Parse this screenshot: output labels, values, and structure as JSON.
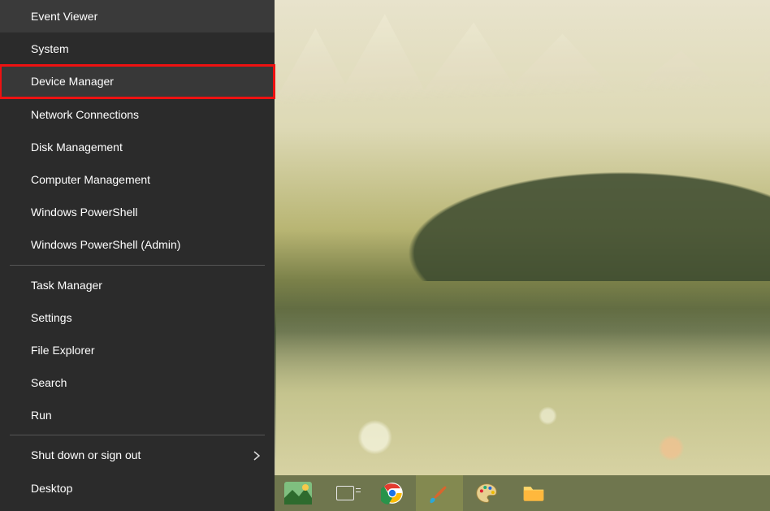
{
  "menu": {
    "groups": [
      {
        "items": [
          {
            "id": "event-viewer",
            "label": "Event Viewer",
            "highlighted": false
          },
          {
            "id": "system",
            "label": "System",
            "highlighted": false
          },
          {
            "id": "device-manager",
            "label": "Device Manager",
            "highlighted": true
          },
          {
            "id": "network-connections",
            "label": "Network Connections",
            "highlighted": false
          },
          {
            "id": "disk-management",
            "label": "Disk Management",
            "highlighted": false
          },
          {
            "id": "computer-management",
            "label": "Computer Management",
            "highlighted": false
          },
          {
            "id": "windows-powershell",
            "label": "Windows PowerShell",
            "highlighted": false
          },
          {
            "id": "windows-powershell-admin",
            "label": "Windows PowerShell (Admin)",
            "highlighted": false
          }
        ]
      },
      {
        "items": [
          {
            "id": "task-manager",
            "label": "Task Manager",
            "highlighted": false
          },
          {
            "id": "settings",
            "label": "Settings",
            "highlighted": false
          },
          {
            "id": "file-explorer",
            "label": "File Explorer",
            "highlighted": false
          },
          {
            "id": "search",
            "label": "Search",
            "highlighted": false
          },
          {
            "id": "run",
            "label": "Run",
            "highlighted": false
          }
        ]
      },
      {
        "items": [
          {
            "id": "shut-down-sign-out",
            "label": "Shut down or sign out",
            "highlighted": false,
            "submenu": true
          },
          {
            "id": "desktop",
            "label": "Desktop",
            "highlighted": false
          }
        ]
      }
    ],
    "highlight_color": "#e11111"
  },
  "taskbar": {
    "items": [
      {
        "id": "wallpaper-tray",
        "icon": "wallpaper-icon",
        "active": false
      },
      {
        "id": "task-view",
        "icon": "task-view-icon",
        "active": false
      },
      {
        "id": "chrome",
        "icon": "chrome-icon",
        "active": false
      },
      {
        "id": "paint-net",
        "icon": "brush-icon",
        "active": true
      },
      {
        "id": "mspaint",
        "icon": "palette-icon",
        "active": false
      },
      {
        "id": "file-explorer",
        "icon": "folder-icon",
        "active": false
      }
    ]
  }
}
